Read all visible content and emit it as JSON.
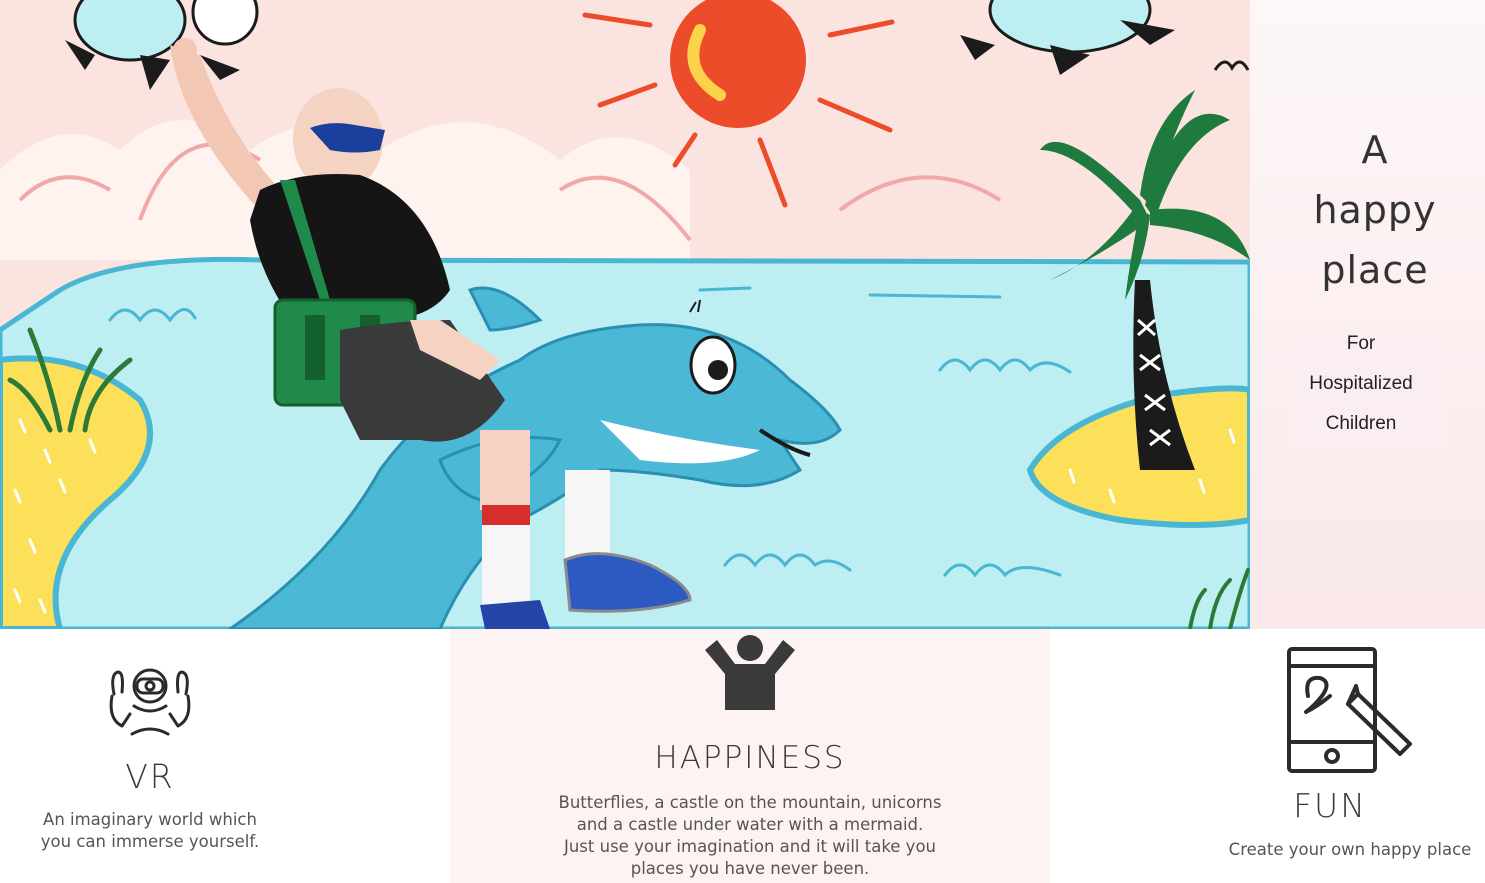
{
  "tagline": {
    "line1": "A",
    "line2": "happy",
    "line3": "place",
    "sub1": "For",
    "sub2": "Hospitalized",
    "sub3": "Children"
  },
  "features": {
    "vr": {
      "icon": "vr-headset-icon",
      "title": "VR",
      "desc1": "An imaginary world which",
      "desc2": "you can immerse yourself."
    },
    "happiness": {
      "icon": "happy-person-icon",
      "title": "HAPPINESS",
      "desc1": "Butterflies, a castle on the mountain, unicorns",
      "desc2": "and a castle under water with a mermaid.",
      "desc3": "Just use your imagination and it will take you",
      "desc4": "places you have never been."
    },
    "fun": {
      "icon": "tablet-drawing-icon",
      "title": "FUN",
      "desc": "Create your own happy place"
    }
  },
  "colors": {
    "sky": "#fbe3e0",
    "water": "#bdeef2",
    "sand": "#fde05a",
    "sun": "#ec4c2a",
    "dolphin": "#4bb8d6",
    "palm": "#1f7a3e",
    "text": "#333333"
  }
}
